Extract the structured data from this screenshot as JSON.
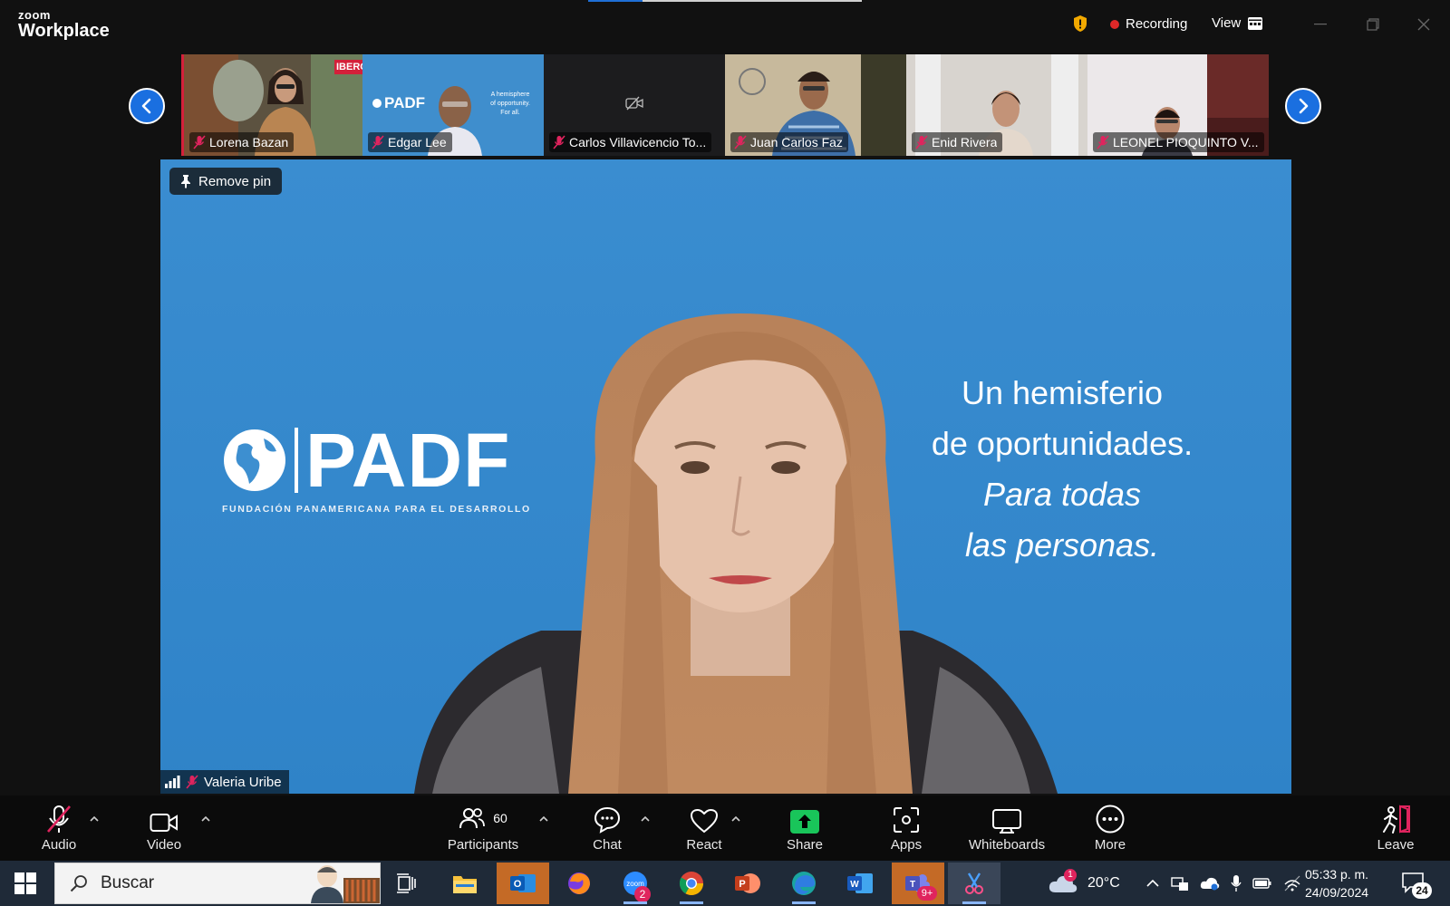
{
  "app": {
    "logo_line1": "zoom",
    "logo_line2": "Workplace",
    "recording_label": "Recording",
    "view_label": "View"
  },
  "thumbnails": [
    {
      "name": "Lorena Bazan",
      "badge": "IBERO"
    },
    {
      "name": "Edgar Lee",
      "logo": "PADF",
      "tagline": "A hemisphere of opportunity. For all."
    },
    {
      "name": "Carlos Villavicencio To..."
    },
    {
      "name": "Juan Carlos Faz"
    },
    {
      "name": "Enid Rivera"
    },
    {
      "name": "LEONEL PIOQUINTO V..."
    }
  ],
  "main": {
    "remove_pin_label": "Remove pin",
    "speaker_name": "Valeria Uribe",
    "background": {
      "logo_word": "PADF",
      "logo_sub": "FUNDACIÓN PANAMERICANA PARA EL DESARROLLO",
      "slogan_line1": "Un hemisferio",
      "slogan_line2": "de oportunidades.",
      "slogan_line3": "Para todas",
      "slogan_line4": "las personas."
    }
  },
  "toolbar": {
    "audio": "Audio",
    "video": "Video",
    "participants": "Participants",
    "participants_count": "60",
    "chat": "Chat",
    "react": "React",
    "share": "Share",
    "apps": "Apps",
    "whiteboards": "Whiteboards",
    "more": "More",
    "leave": "Leave"
  },
  "taskbar": {
    "search_placeholder": "Buscar",
    "zoom_badge": "2",
    "teams_badge": "9+",
    "weather_badge": "1",
    "temperature": "20°C",
    "time": "05:33 p. m.",
    "date": "24/09/2024",
    "notifications_count": "24"
  },
  "colors": {
    "accent_blue": "#1a6fe0",
    "share_green": "#19c55a",
    "mute_red": "#e0245e",
    "recording_red": "#e02828",
    "slide_blue": "#3d8fd0"
  }
}
